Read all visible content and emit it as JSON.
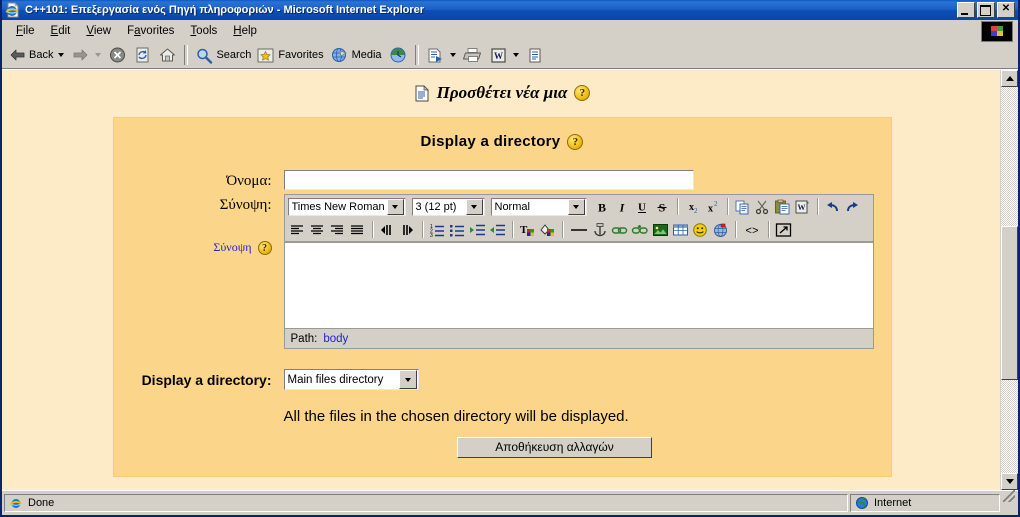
{
  "window": {
    "title": "C++101: Επεξεργασία ενός Πηγή πληροφοριών - Microsoft Internet Explorer",
    "icon": "ie-document-icon",
    "minimize_label": "_",
    "maximize_label": "□",
    "close_label": "✕"
  },
  "menubar": {
    "items": [
      {
        "label": "File",
        "accel": "F"
      },
      {
        "label": "Edit",
        "accel": "E"
      },
      {
        "label": "View",
        "accel": "V"
      },
      {
        "label": "Favorites",
        "accel": "a"
      },
      {
        "label": "Tools",
        "accel": "T"
      },
      {
        "label": "Help",
        "accel": "H"
      }
    ]
  },
  "toolbar": {
    "back_label": "Back",
    "search_label": "Search",
    "favorites_label": "Favorites",
    "media_label": "Media",
    "buttons": [
      "back-button",
      "forward-button",
      "stop-button",
      "refresh-button",
      "home-button",
      "search-button",
      "favorites-button",
      "media-button",
      "history-button",
      "mail-button",
      "print-button",
      "edit-word-button",
      "discuss-button"
    ]
  },
  "page": {
    "heading": "Προσθέτει νέα μια",
    "heading_icon": "document-icon",
    "help_icon": "?",
    "form": {
      "title": "Display a directory",
      "name_label": "Όνομα:",
      "name_value": "",
      "name_placeholder": "",
      "summary_label": "Σύνοψη:",
      "summary_hint_link": "Σύνοψη",
      "summary_value": "",
      "editor": {
        "font_family": "Times New Roman",
        "font_size": "3 (12 pt)",
        "format": "Normal",
        "row1_buttons": [
          "bold-button",
          "italic-button",
          "underline-button",
          "strikethrough-button",
          "subscript-button",
          "superscript-button",
          "copy-button",
          "cut-button",
          "paste-button",
          "paste-from-word-button",
          "undo-button",
          "redo-button"
        ],
        "row2_buttons": [
          "align-left-button",
          "align-center-button",
          "align-right-button",
          "align-justify-button",
          "direction-ltr-button",
          "direction-rtl-button",
          "ordered-list-button",
          "unordered-list-button",
          "outdent-button",
          "indent-button",
          "text-color-button",
          "background-color-button",
          "horizontal-rule-button",
          "anchor-button",
          "insert-link-button",
          "unlink-button",
          "insert-image-button",
          "insert-table-button",
          "emoticon-button",
          "insert-media-button",
          "html-source-button",
          "fullscreen-button"
        ],
        "path_label": "Path:",
        "path_value": "body"
      },
      "directory_label": "Display a directory:",
      "directory_value": "Main files directory",
      "description": "All the files in the chosen directory will be displayed.",
      "submit_label": "Αποθήκευση αλλαγών"
    }
  },
  "statusbar": {
    "status_text": "Done",
    "zone_text": "Internet",
    "zone_icon": "globe-icon",
    "status_icon": "ie-icon"
  },
  "colors": {
    "titlebar": "#0A4FB4",
    "page_bg": "#FDEBC8",
    "form_bg": "#FBD68A",
    "chrome": "#D4D0C8",
    "link": "#2222CC"
  }
}
